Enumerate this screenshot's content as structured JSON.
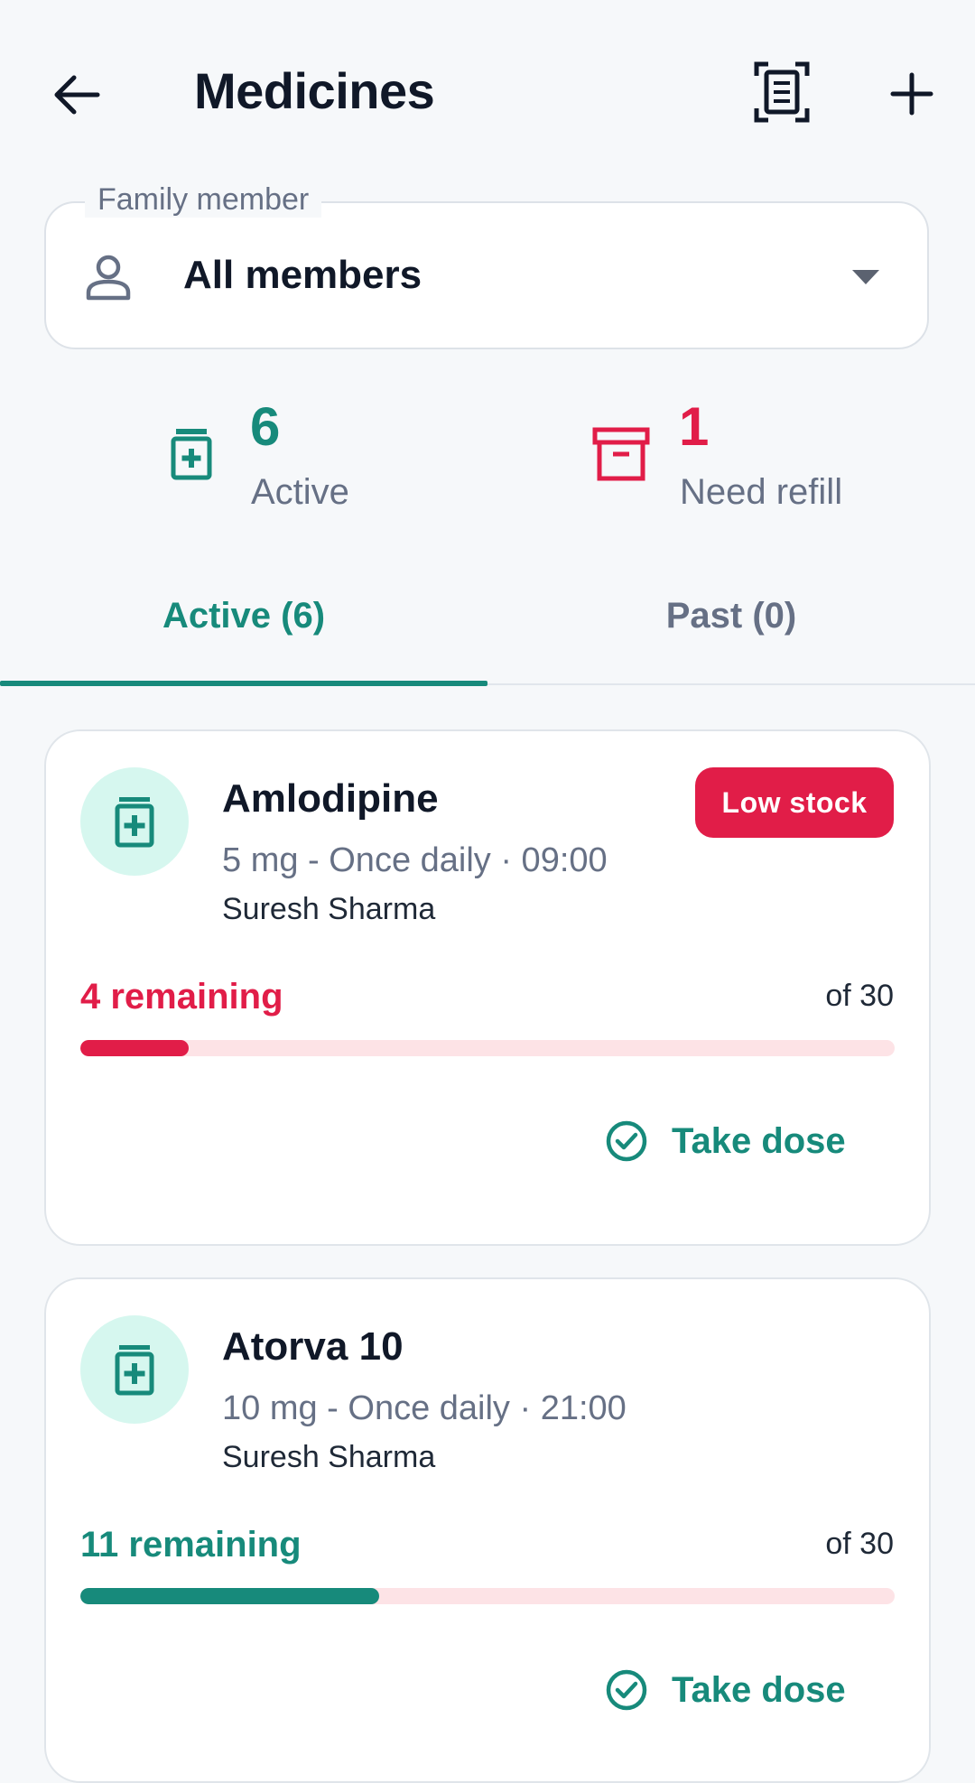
{
  "header": {
    "title": "Medicines",
    "back_icon": "arrow-left-icon",
    "scan_icon": "document-scan-icon",
    "add_icon": "plus-icon"
  },
  "member_select": {
    "legend": "Family member",
    "value": "All members",
    "icon": "person-icon"
  },
  "stats": {
    "active": {
      "count": "6",
      "label": "Active",
      "icon": "medicine-bottle-icon",
      "color": "#178a7b"
    },
    "refill": {
      "count": "1",
      "label": "Need refill",
      "icon": "archive-box-icon",
      "color": "#e11d48"
    }
  },
  "tabs": [
    {
      "label": "Active (6)",
      "selected": true
    },
    {
      "label": "Past (0)",
      "selected": false
    }
  ],
  "medicines": [
    {
      "name": "Amlodipine",
      "dose": "5 mg - Once daily",
      "time": "09:00",
      "dose_line": "5 mg - Once daily · 09:00",
      "person": "Suresh Sharma",
      "badge": "Low stock",
      "remaining_label": "4 remaining",
      "of_label": "of 30",
      "remaining": 4,
      "total": 30,
      "status_color": "#e11d48",
      "action": "Take dose"
    },
    {
      "name": "Atorva 10",
      "dose": "10 mg - Once daily",
      "time": "21:00",
      "dose_line": "10 mg - Once daily · 21:00",
      "person": "Suresh Sharma",
      "badge": "",
      "remaining_label": "11 remaining",
      "of_label": "of 30",
      "remaining": 11,
      "total": 30,
      "status_color": "#178a7b",
      "action": "Take dose"
    }
  ],
  "colors": {
    "accent": "#178a7b",
    "danger": "#e11d48",
    "track": "#fde3e6",
    "icon_circle": "#d6f7ef"
  }
}
